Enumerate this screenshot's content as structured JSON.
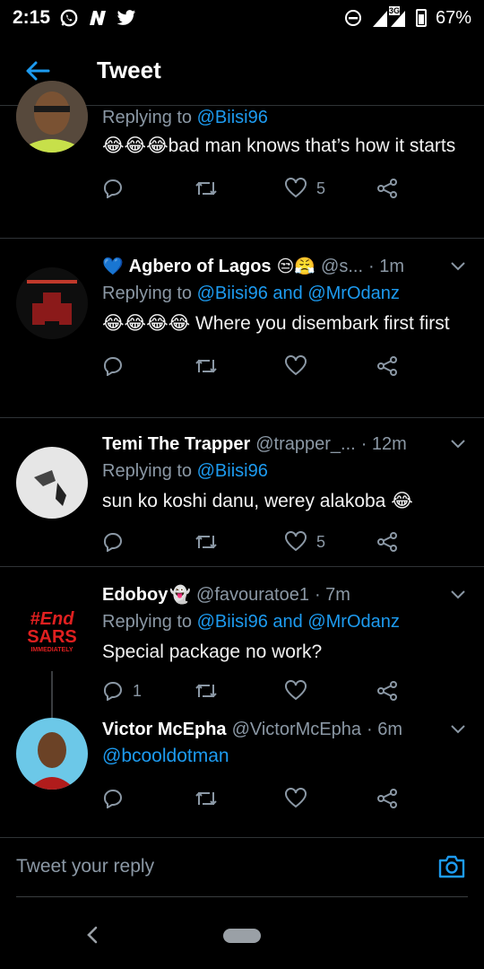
{
  "status_bar": {
    "time": "2:15",
    "network": "3G",
    "battery": "67%",
    "icons": [
      "whatsapp-icon",
      "n-icon",
      "twitter-icon",
      "dnd-icon",
      "signal-icon",
      "battery-icon"
    ]
  },
  "app_bar": {
    "title": "Tweet",
    "back_icon": "arrow-left-icon"
  },
  "tweets": [
    {
      "name": "",
      "handle": "",
      "time": "",
      "replying_prefix": "Replying to ",
      "replying_to": "@Biisi96",
      "text": "😂😂😂bad man knows that’s how it starts",
      "reply_count": "",
      "like_count": "5"
    },
    {
      "name_emoji_prefix": "💙",
      "name": "Agbero of Lagos",
      "name_emoji_suffix": "😒😤",
      "handle": "@s...",
      "time": "· 1m",
      "replying_prefix": "Replying to ",
      "replying_to": "@Biisi96 and @MrOdanz",
      "text": "😂😂😂😂 Where you  disembark first first",
      "reply_count": "",
      "like_count": ""
    },
    {
      "name": "Temi The Trapper",
      "handle": "@trapper_...",
      "time": "· 12m",
      "replying_prefix": "Replying to ",
      "replying_to": "@Biisi96",
      "text": "sun ko koshi danu, werey alakoba 😂",
      "reply_count": "",
      "like_count": "5"
    },
    {
      "name": "Edoboy",
      "name_emoji_suffix": "👻",
      "handle": "@favouratoe1",
      "time": "· 7m",
      "replying_prefix": "Replying to ",
      "replying_to": "@Biisi96 and @MrOdanz",
      "text": "Special package no work?",
      "reply_count": "1",
      "like_count": "",
      "avatar_text": [
        "#End",
        "SARS",
        "IMMEDIATELY"
      ]
    },
    {
      "name": "Victor McEpha",
      "handle": "@VictorMcEpha",
      "time": "· 6m",
      "text": "@bcooldotman",
      "reply_count": "",
      "like_count": ""
    }
  ],
  "reply_bar": {
    "placeholder": "Tweet your reply",
    "camera_icon": "camera-icon"
  },
  "nav": {
    "back_icon": "chevron-left-icon",
    "home_icon": "home-pill-icon"
  },
  "colors": {
    "accent": "#1d9bf0",
    "background": "#000000",
    "secondary_text": "#8b98a5",
    "divider": "#2f3336"
  }
}
